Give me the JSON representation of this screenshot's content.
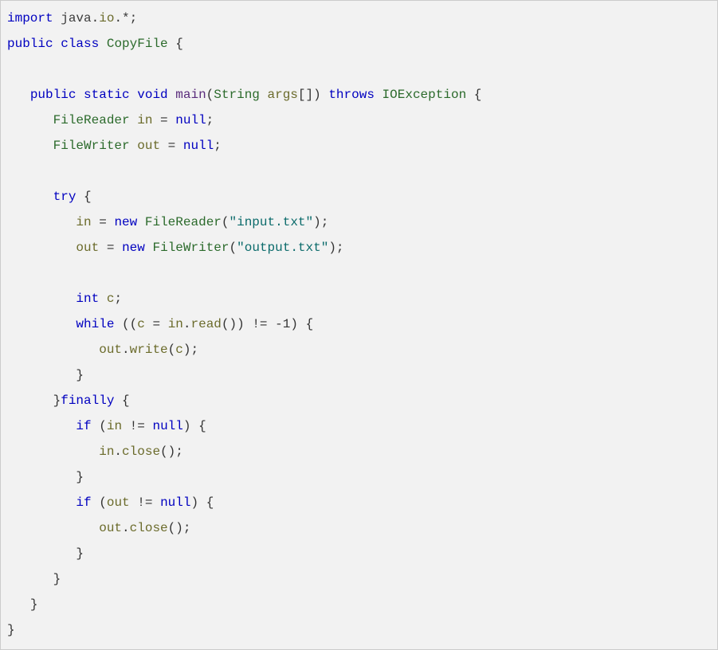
{
  "code": {
    "language": "Java",
    "class_name": "CopyFile",
    "method_name": "main",
    "param_type": "String",
    "param_name": "args",
    "throws_type": "IOException",
    "reader_type": "FileReader",
    "writer_type": "FileWriter",
    "var_in": "in",
    "var_out": "out",
    "var_c": "c",
    "null_literal": "null",
    "input_file": "\"input.txt\"",
    "output_file": "\"output.txt\"",
    "neg_one": "1",
    "kw_import": "import",
    "kw_public": "public",
    "kw_class": "class",
    "kw_static": "static",
    "kw_void": "void",
    "kw_throws": "throws",
    "kw_try": "try",
    "kw_finally": "finally",
    "kw_if": "if",
    "kw_while": "while",
    "kw_new": "new",
    "kw_int": "int",
    "pkg_java": "java",
    "pkg_io": "io",
    "method_read": "read",
    "method_write": "write",
    "method_close": "close"
  }
}
